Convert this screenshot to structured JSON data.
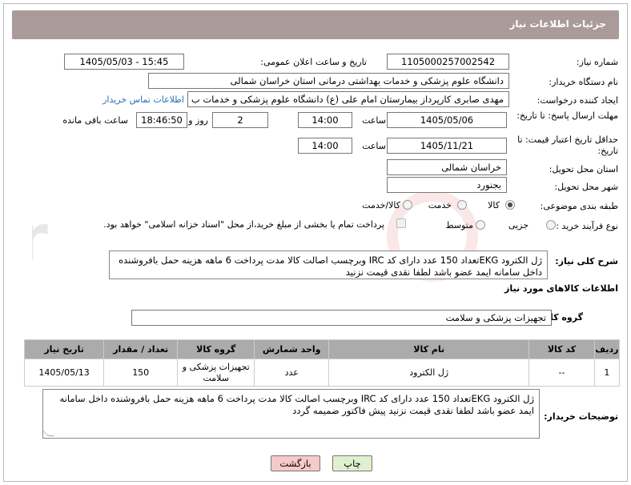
{
  "header": {
    "title": "جزئیات اطلاعات نیاز"
  },
  "fields": {
    "need_number": {
      "label": "شماره نیاز:",
      "value": "1105000257002542"
    },
    "announce_datetime": {
      "label": "تاریخ و ساعت اعلان عمومی:",
      "value": "1405/05/03 - 15:45"
    },
    "buyer_org": {
      "label": "نام دستگاه خریدار:",
      "value": "دانشگاه علوم پزشکی و خدمات بهداشتی درمانی استان خراسان شمالی"
    },
    "requester": {
      "label": "ایجاد کننده درخواست:",
      "value": "مهدی صابری کارپرداز بیمارستان امام علی (ع) دانشگاه علوم پزشکی و خدمات ب",
      "contact_link": "اطلاعات تماس خریدار"
    },
    "reply_deadline": {
      "label": "مهلت ارسال پاسخ: تا تاریخ:",
      "date": "1405/05/06",
      "time_label": "ساعت",
      "time": "14:00",
      "days": "2",
      "days_label": "روز و",
      "remaining": "18:46:50",
      "remaining_label": "ساعت باقی مانده"
    },
    "price_validity": {
      "label": "حداقل تاریخ اعتبار قیمت: تا تاریخ:",
      "date": "1405/11/21",
      "time_label": "ساعت",
      "time": "14:00"
    },
    "delivery_province": {
      "label": "استان محل تحویل:",
      "value": "خراسان شمالی"
    },
    "delivery_city": {
      "label": "شهر محل تحویل:",
      "value": "بجنورد"
    },
    "category": {
      "label": "طبقه بندی موضوعی:",
      "options": [
        "کالا",
        "خدمت",
        "کالا/خدمت"
      ],
      "selected": "کالا"
    },
    "purchase_process": {
      "label": "نوع فرآیند خرید :",
      "options": [
        "جزیی",
        "متوسط"
      ],
      "payment_text": "پرداخت تمام یا بخشی از مبلغ خرید،از محل \"اسناد خزانه اسلامی\" خواهد بود."
    },
    "general_desc": {
      "label": "شرح کلی نیاز:",
      "value": "ژل الکترود EKGتعداد 150 عدد دارای کد IRC وبرچسب اصالت کالا مدت پرداخت 6 ماهه هزینه حمل بافروشنده داخل سامانه ایمد عضو باشد لطفا نقدی قیمت نزنید"
    }
  },
  "goods_section": {
    "title": "اطلاعات کالاهای مورد نیاز",
    "group_label": "گروه کالا:",
    "group_value": "تجهیزات پزشکی و سلامت",
    "columns": [
      "ردیف",
      "کد کالا",
      "نام کالا",
      "واحد شمارش",
      "گروه کالا",
      "تعداد / مقدار",
      "تاریخ نیاز"
    ],
    "rows": [
      {
        "row": "1",
        "code": "--",
        "name": "ژل الکترود",
        "unit": "عدد",
        "group": "تجهیزات پزشکی و سلامت",
        "qty": "150",
        "date": "1405/05/13"
      }
    ]
  },
  "buyer_notes": {
    "label": "توضیحات خریدار:",
    "value": "ژل الکترود EKGتعداد 150 عدد دارای کد IRC وبرچسب اصالت کالا مدت پرداخت 6 ماهه هزینه حمل بافروشنده داخل سامانه ایمد عضو باشد لطفا نقدی قیمت نزنید  پیش فاکتور ضمیمه گردد"
  },
  "buttons": {
    "print": "چاپ",
    "back": "بازگشت"
  },
  "colors": {
    "header_bg": "#aa9b9a",
    "table_header_bg": "#ababab",
    "link": "#2a6fb8",
    "back_button_bg": "#f7c9c9",
    "print_button_bg": "#dff0d0"
  }
}
